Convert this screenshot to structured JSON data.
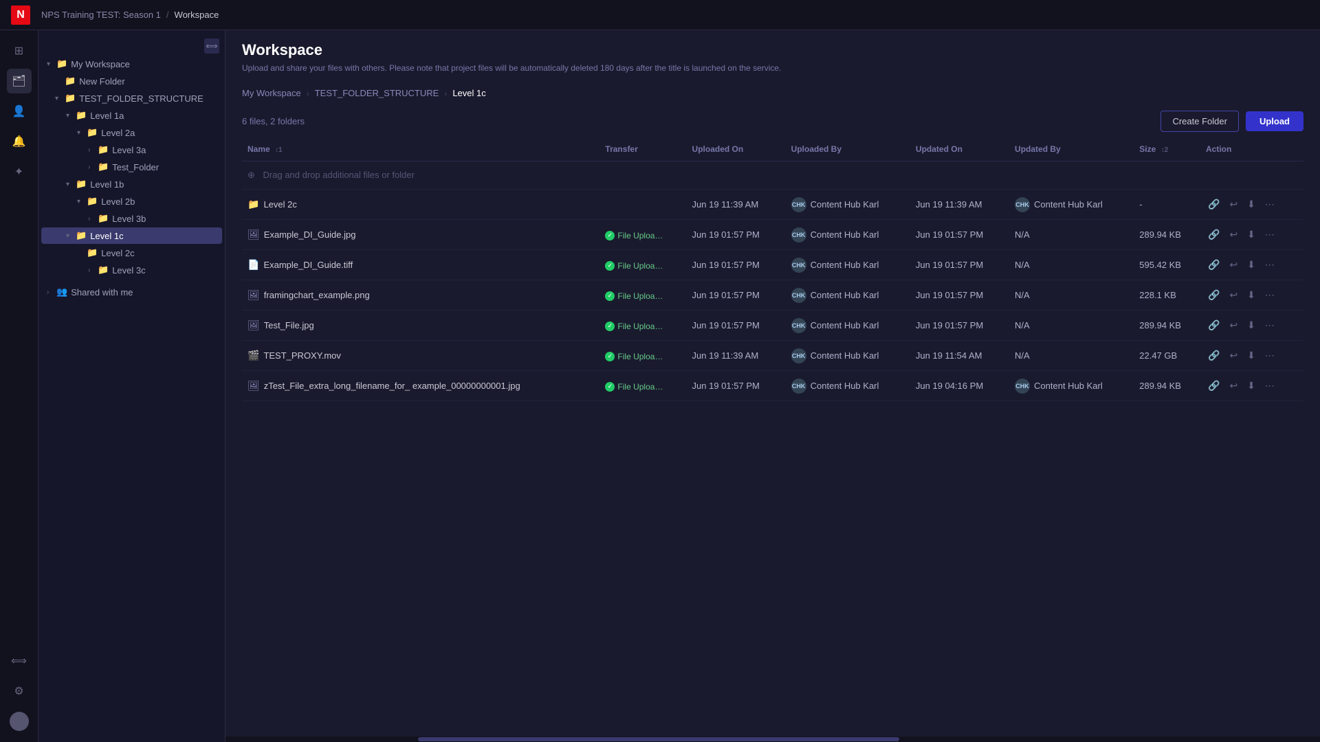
{
  "app": {
    "logo": "N",
    "breadcrumb": {
      "project": "NPS Training TEST: Season 1",
      "separator": "/",
      "current": "Workspace"
    }
  },
  "page": {
    "title": "Workspace",
    "subtitle": "Upload and share your files with others. Please note that project files will be automatically deleted 180 days after the title is launched on the service."
  },
  "folder_nav": {
    "items": [
      {
        "label": "My Workspace",
        "id": "root"
      },
      {
        "label": "TEST_FOLDER_STRUCTURE",
        "id": "tfs"
      },
      {
        "label": "Level 1c",
        "id": "l1c"
      }
    ]
  },
  "toolbar": {
    "file_count": "6 files, 2 folders",
    "create_folder_label": "Create Folder",
    "upload_label": "Upload"
  },
  "table": {
    "columns": [
      {
        "label": "Name",
        "sort": "↕1"
      },
      {
        "label": "Transfer"
      },
      {
        "label": "Uploaded On"
      },
      {
        "label": "Uploaded By"
      },
      {
        "label": "Updated On"
      },
      {
        "label": "Updated By"
      },
      {
        "label": "Size",
        "sort": "↕2"
      },
      {
        "label": "Action"
      }
    ],
    "drag_drop_text": "Drag and drop additional files or folder",
    "rows": [
      {
        "type": "folder",
        "name": "Level 2c",
        "transfer": "",
        "uploaded_on": "Jun 19 11:39 AM",
        "uploaded_by": "Content Hub Karl",
        "updated_on": "Jun 19 11:39 AM",
        "updated_by": "Content Hub Karl",
        "size": "-",
        "uploader_initials": "CHK"
      },
      {
        "type": "image",
        "name": "Example_DI_Guide.jpg",
        "transfer": "File Uploa…",
        "uploaded_on": "Jun 19 01:57 PM",
        "uploaded_by": "Content Hub Karl",
        "updated_on": "Jun 19 01:57 PM",
        "updated_by": "N/A",
        "size": "289.94 KB",
        "uploader_initials": "CHK"
      },
      {
        "type": "file",
        "name": "Example_DI_Guide.tiff",
        "transfer": "File Uploa…",
        "uploaded_on": "Jun 19 01:57 PM",
        "uploaded_by": "Content Hub Karl",
        "updated_on": "Jun 19 01:57 PM",
        "updated_by": "N/A",
        "size": "595.42 KB",
        "uploader_initials": "CHK"
      },
      {
        "type": "image",
        "name": "framingchart_example.png",
        "transfer": "File Uploa…",
        "uploaded_on": "Jun 19 01:57 PM",
        "uploaded_by": "Content Hub Karl",
        "updated_on": "Jun 19 01:57 PM",
        "updated_by": "N/A",
        "size": "228.1 KB",
        "uploader_initials": "CHK"
      },
      {
        "type": "image",
        "name": "Test_File.jpg",
        "transfer": "File Uploa…",
        "uploaded_on": "Jun 19 01:57 PM",
        "uploaded_by": "Content Hub Karl",
        "updated_on": "Jun 19 01:57 PM",
        "updated_by": "N/A",
        "size": "289.94 KB",
        "uploader_initials": "CHK"
      },
      {
        "type": "video",
        "name": "TEST_PROXY.mov",
        "transfer": "File Uploa…",
        "uploaded_on": "Jun 19 11:39 AM",
        "uploaded_by": "Content Hub Karl",
        "updated_on": "Jun 19 11:54 AM",
        "updated_by": "N/A",
        "size": "22.47 GB",
        "uploader_initials": "CHK"
      },
      {
        "type": "image",
        "name": "zTest_File_extra_long_filename_for_ example_00000000001.jpg",
        "transfer": "File Uploa…",
        "uploaded_on": "Jun 19 01:57 PM",
        "uploaded_by": "Content Hub Karl",
        "updated_on": "Jun 19 04:16 PM",
        "updated_by": "Content Hub Karl",
        "size": "289.94 KB",
        "uploader_initials": "CHK"
      }
    ]
  },
  "sidebar": {
    "my_workspace_label": "My Workspace",
    "new_folder_label": "New Folder",
    "items": [
      {
        "label": "TEST_FOLDER_STRUCTURE",
        "depth": 1,
        "expanded": true
      },
      {
        "label": "Level 1a",
        "depth": 2,
        "expanded": true
      },
      {
        "label": "Level 2a",
        "depth": 3,
        "expanded": true
      },
      {
        "label": "Level 3a",
        "depth": 4
      },
      {
        "label": "Test_Folder",
        "depth": 4
      },
      {
        "label": "Level 1b",
        "depth": 2,
        "expanded": true
      },
      {
        "label": "Level 2b",
        "depth": 3,
        "expanded": true
      },
      {
        "label": "Level 3b",
        "depth": 4
      },
      {
        "label": "Level 1c",
        "depth": 2,
        "active": true,
        "expanded": true
      },
      {
        "label": "Level 2c",
        "depth": 3
      },
      {
        "label": "Level 3c",
        "depth": 4
      }
    ],
    "shared_with_me_label": "Shared with me"
  },
  "icons": {
    "folder": "📁",
    "image": "🖼",
    "file": "📄",
    "video": "🎬",
    "link": "🔗",
    "share": "↩",
    "download": "⬇",
    "more": "⋯",
    "chevron_right": "›",
    "chevron_down": "˅",
    "drag": "⊕",
    "grid": "⊞",
    "files": "🗂",
    "gear": "⚙",
    "collapse": "⟺",
    "user": "👤",
    "bell": "🔔",
    "ai": "✦"
  }
}
